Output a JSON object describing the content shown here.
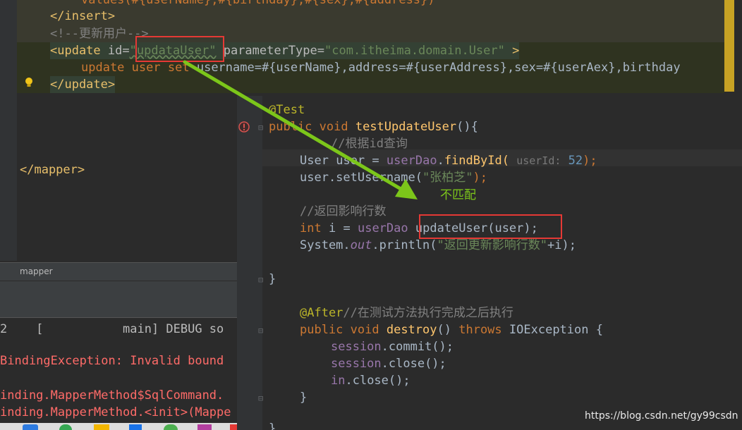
{
  "bg_editor": {
    "line1": "values(#{userName},#{birthday},#{sex},#{address})",
    "insert_close": "</insert>",
    "comment": "<!--更新用户-->",
    "update_open_tag": "<update",
    "id_attr": "id=",
    "id_value": "\"updataUser\"",
    "param_attr": "parameterType=",
    "param_value": "\"com.itheima.domain.User\"",
    "update_open_end": ">",
    "sql_update": "update",
    "sql_table": "user",
    "sql_set": "set",
    "sql_rest": "username=#{userName},address=#{userAddress},sex=#{userAex},birthday",
    "update_close": "</update>",
    "mapper_close": "</mapper>"
  },
  "bottom_panel": {
    "breadcrumb": "mapper",
    "console_lines": [
      "2    [           main] DEBUG so",
      "BindingException: Invalid bound",
      "inding.MapperMethod$SqlCommand.",
      "inding.MapperMethod.<init>(Mappe"
    ]
  },
  "overlay": {
    "annotation_test": "@Test",
    "method_sig_kw": "public void",
    "method_name": "testUpdateUser",
    "method_sig_end": "(){",
    "comment1": "//根据id查询",
    "l3_type": "User",
    "l3_var": "user",
    "l3_eq": "=",
    "l3_dao": "userDao",
    "l3_call": "findById(",
    "l3_hint": "userId:",
    "l3_num": "52",
    "l3_end": ");",
    "l4_a": "user.setUsername(",
    "l4_str": "\"张柏芝\"",
    "l4_end": ");",
    "mismatch_label": "不匹配",
    "comment2": "//返回影响行数",
    "l6_kw": "int",
    "l6_var": "i",
    "l6_eq": "=",
    "l6_dao": "userDao",
    "l6_call": "updateUser(user);",
    "l7_a": "System.",
    "l7_out": "out",
    "l7_b": ".println(",
    "l7_str": "\"返回更新影响行数\"",
    "l7_end": "+i);",
    "close_brace": "}",
    "annotation_after": "@After",
    "comment3": "//在测试方法执行完成之后执行",
    "destroy_kw": "public void",
    "destroy_name": "destroy",
    "destroy_mid": "()",
    "destroy_throws": "throws",
    "destroy_exc": "IOException {",
    "d1_field": "session",
    "d1_rest": ".commit();",
    "d2_field": "session",
    "d2_rest": ".close();",
    "d3_field": "in",
    "d3_rest": ".close();",
    "d_close": "}",
    "last_brace": "}"
  },
  "watermark": "https://blog.csdn.net/gy99csdn",
  "colors": {
    "keyword": "#cc7832",
    "tag": "#e8bf6a",
    "string": "#6a8759",
    "function": "#ffc66d",
    "field": "#9876aa",
    "comment": "#808080",
    "annotation": "#bbb529",
    "highlight_box": "#e53935",
    "arrow": "#7cc61a"
  }
}
